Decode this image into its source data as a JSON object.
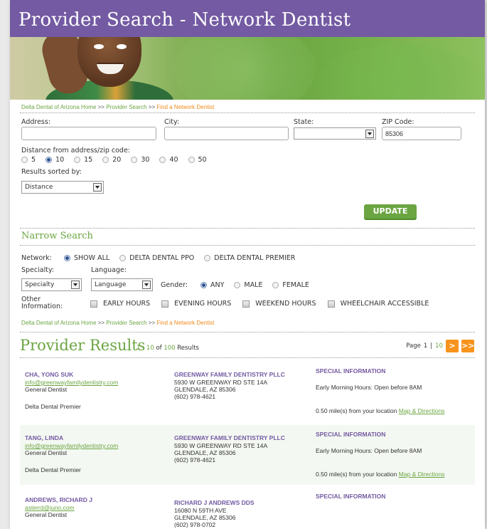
{
  "title": "Provider Search - Network Dentist",
  "breadcrumb": {
    "home": "Delta Dental of Arizona Home",
    "sep1": ">>",
    "search": "Provider Search",
    "sep2": ">>",
    "current": "Find a Network Dentist"
  },
  "form": {
    "address_label": "Address:",
    "address_value": "",
    "city_label": "City:",
    "city_value": "",
    "state_label": "State:",
    "state_value": "",
    "zip_label": "ZIP Code:",
    "zip_value": "85306",
    "distance_label": "Distance from address/zip code:",
    "distance_options": [
      "5",
      "10",
      "15",
      "20",
      "30",
      "40",
      "50"
    ],
    "distance_selected": "10",
    "sort_label": "Results sorted by:",
    "sort_value": "Distance",
    "update_label": "UPDATE"
  },
  "narrow": {
    "title": "Narrow Search",
    "network_label": "Network:",
    "network_options": [
      "SHOW ALL",
      "DELTA DENTAL PPO",
      "DELTA DENTAL PREMIER"
    ],
    "network_selected": "SHOW ALL",
    "specialty_label": "Specialty:",
    "specialty_value": "Specialty",
    "language_label": "Language:",
    "language_value": "Language",
    "gender_label": "Gender:",
    "gender_options": [
      "ANY",
      "MALE",
      "FEMALE"
    ],
    "gender_selected": "ANY",
    "other_label_1": "Other",
    "other_label_2": "Information:",
    "other_options": [
      "EARLY HOURS",
      "EVENING HOURS",
      "WEEKEND HOURS",
      "WHEELCHAIR ACCESSIBLE"
    ]
  },
  "results": {
    "title": "Provider Results",
    "range_start": "1",
    "range_dash": "-",
    "range_end": "10",
    "of_label": "of",
    "total": "100",
    "results_label": "Results",
    "page_label": "Page",
    "page_current": "1",
    "page_sep": "|",
    "page_total": "10",
    "next_icon": ">",
    "last_icon": ">>",
    "items": [
      {
        "name": "CHA, YONG SUK",
        "email": "info@greenwayfamilydentistry.com",
        "specialty": "General Dentist",
        "network": "Delta Dental Premier",
        "practice": "GREENWAY FAMILY DENTISTRY PLLC",
        "street": "5930 W GREENWAY RD STE 14A",
        "city": "GLENDALE, AZ 85306",
        "phone": "(602) 978-4621",
        "info_heading": "SPECIAL INFORMATION",
        "info": "Early Morning Hours: Open before 8AM",
        "distance": "0.50 mile(s) from your location",
        "map_link": "Map & Directions"
      },
      {
        "name": "TANG, LINDA",
        "email": "info@greenwayfamilydentistry.com",
        "specialty": "General Dentist",
        "network": "Delta Dental Premier",
        "practice": "GREENWAY FAMILY DENTISTRY PLLC",
        "street": "5930 W GREENWAY RD STE 14A",
        "city": "GLENDALE, AZ 85306",
        "phone": "(602) 978-4621",
        "info_heading": "SPECIAL INFORMATION",
        "info": "Early Morning Hours: Open before 8AM",
        "distance": "0.50 mile(s) from your location",
        "map_link": "Map & Directions"
      },
      {
        "name": "ANDREWS, RICHARD J",
        "email": "asterrd@juno.com",
        "specialty": "General Dentist",
        "network": "",
        "practice": "RICHARD J ANDREWS DDS",
        "street": "16080 N 59TH AVE",
        "city": "GLENDALE, AZ 85306",
        "phone": "(602) 978-0702",
        "info_heading": "SPECIAL INFORMATION",
        "info": "",
        "distance": "",
        "map_link": ""
      }
    ]
  }
}
